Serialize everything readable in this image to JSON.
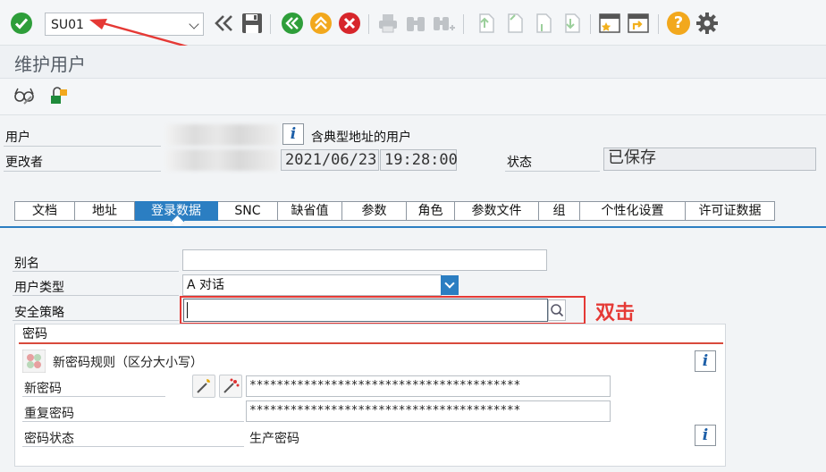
{
  "toolbar": {
    "command_field": "SU01",
    "icons": [
      "enter-check-icon",
      "back-double-arrow-icon",
      "save-icon",
      "back-green-icon",
      "exit-up-icon",
      "cancel-red-icon",
      "print-icon",
      "find-icon",
      "find-next-icon",
      "first-page-icon",
      "previous-page-icon",
      "next-page-icon",
      "last-page-icon",
      "new-session-icon",
      "shortcut-icon",
      "help-icon",
      "gear-icon"
    ],
    "help_label": "?"
  },
  "title": "维护用户",
  "app_toolbar": {
    "icons": [
      "display-change-glasses-icon",
      "lock-unlock-icon"
    ]
  },
  "header": {
    "user_label": "用户",
    "user_value": "",
    "user_desc": "含典型地址的用户",
    "changed_by_label": "更改者",
    "changed_by_value": "",
    "date": "2021/06/23",
    "time": "19:28:00",
    "status_label": "状态",
    "status_value": "已保存",
    "info_label": "i"
  },
  "tabs": [
    {
      "label": "文档"
    },
    {
      "label": "地址"
    },
    {
      "label": "登录数据",
      "active": true
    },
    {
      "label": "SNC"
    },
    {
      "label": "缺省值"
    },
    {
      "label": "参数"
    },
    {
      "label": "角色"
    },
    {
      "label": "参数文件"
    },
    {
      "label": "组"
    },
    {
      "label": "个性化设置"
    },
    {
      "label": "许可证数据"
    }
  ],
  "logon": {
    "alias_label": "别名",
    "alias_value": "",
    "user_type_label": "用户类型",
    "user_type_value": "A 对话",
    "security_policy_label": "安全策略",
    "security_policy_value": "",
    "annotation": "双击"
  },
  "password": {
    "group_title": "密码",
    "rules_label": "新密码规则（区分大小写）",
    "new_pw_label": "新密码",
    "new_pw_value": "****************************************",
    "repeat_pw_label": "重复密码",
    "repeat_pw_value": "****************************************",
    "status_label": "密码状态",
    "status_value": "生产密码",
    "info_label": "i"
  },
  "colors": {
    "accent": "#2b7ec2",
    "annotation_red": "#e53935"
  }
}
